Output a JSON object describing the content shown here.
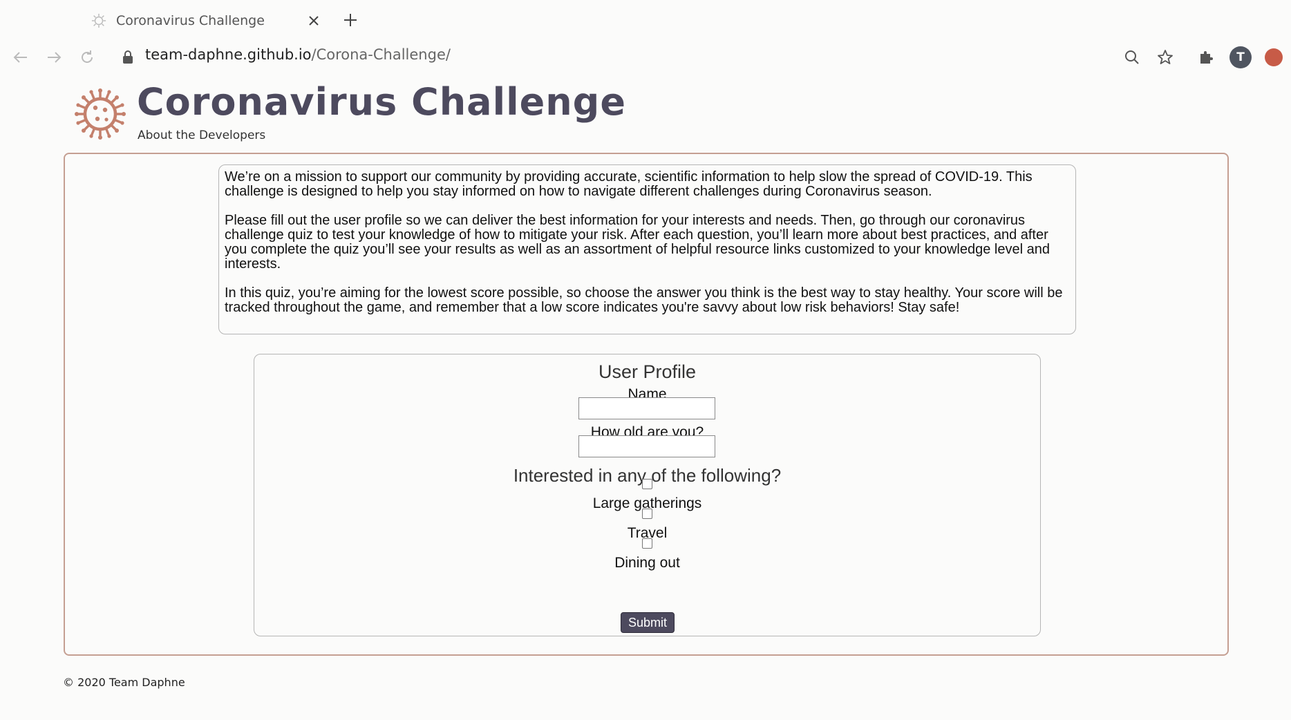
{
  "browser": {
    "tab_title": "Coronavirus Challenge",
    "url_domain": "team-daphne.github.io",
    "url_path": "/Corona-Challenge/",
    "profile_initial": "T"
  },
  "header": {
    "title": "Coronavirus Challenge",
    "about_link": "About the Developers",
    "accent_color": "#c4806c",
    "title_color": "#4d4a5e"
  },
  "intro": {
    "paragraphs": [
      "We’re on a mission to support our community by providing accurate, scientific information to help slow the spread of COVID-19. This challenge is designed to help you stay informed on how to navigate different challenges during Coronavirus season.",
      "Please fill out the user profile so we can deliver the best information for your interests and needs. Then, go through our coronavirus challenge quiz to test your knowledge of how to mitigate your risk. After each question, you’ll learn more about best practices, and after you complete the quiz you’ll see your results as well as an assortment of helpful resource links customized to your knowledge level and interests.",
      "In this quiz, you’re aiming for the lowest score possible, so choose the answer you think is the best way to stay healthy. Your score will be tracked throughout the game, and remember that a low score indicates you're savvy about low risk behaviors! Stay safe!"
    ]
  },
  "profile": {
    "title": "User Profile",
    "name_label": "Name",
    "name_value": "",
    "age_label": "How old are you?",
    "age_value": "",
    "interests_heading": "Interested in any of the following?",
    "interests": [
      {
        "label": "Large gatherings",
        "checked": false
      },
      {
        "label": "Travel",
        "checked": false
      },
      {
        "label": "Dining out",
        "checked": false
      }
    ],
    "submit_label": "Submit"
  },
  "footer": {
    "text": "© 2020 Team Daphne"
  }
}
